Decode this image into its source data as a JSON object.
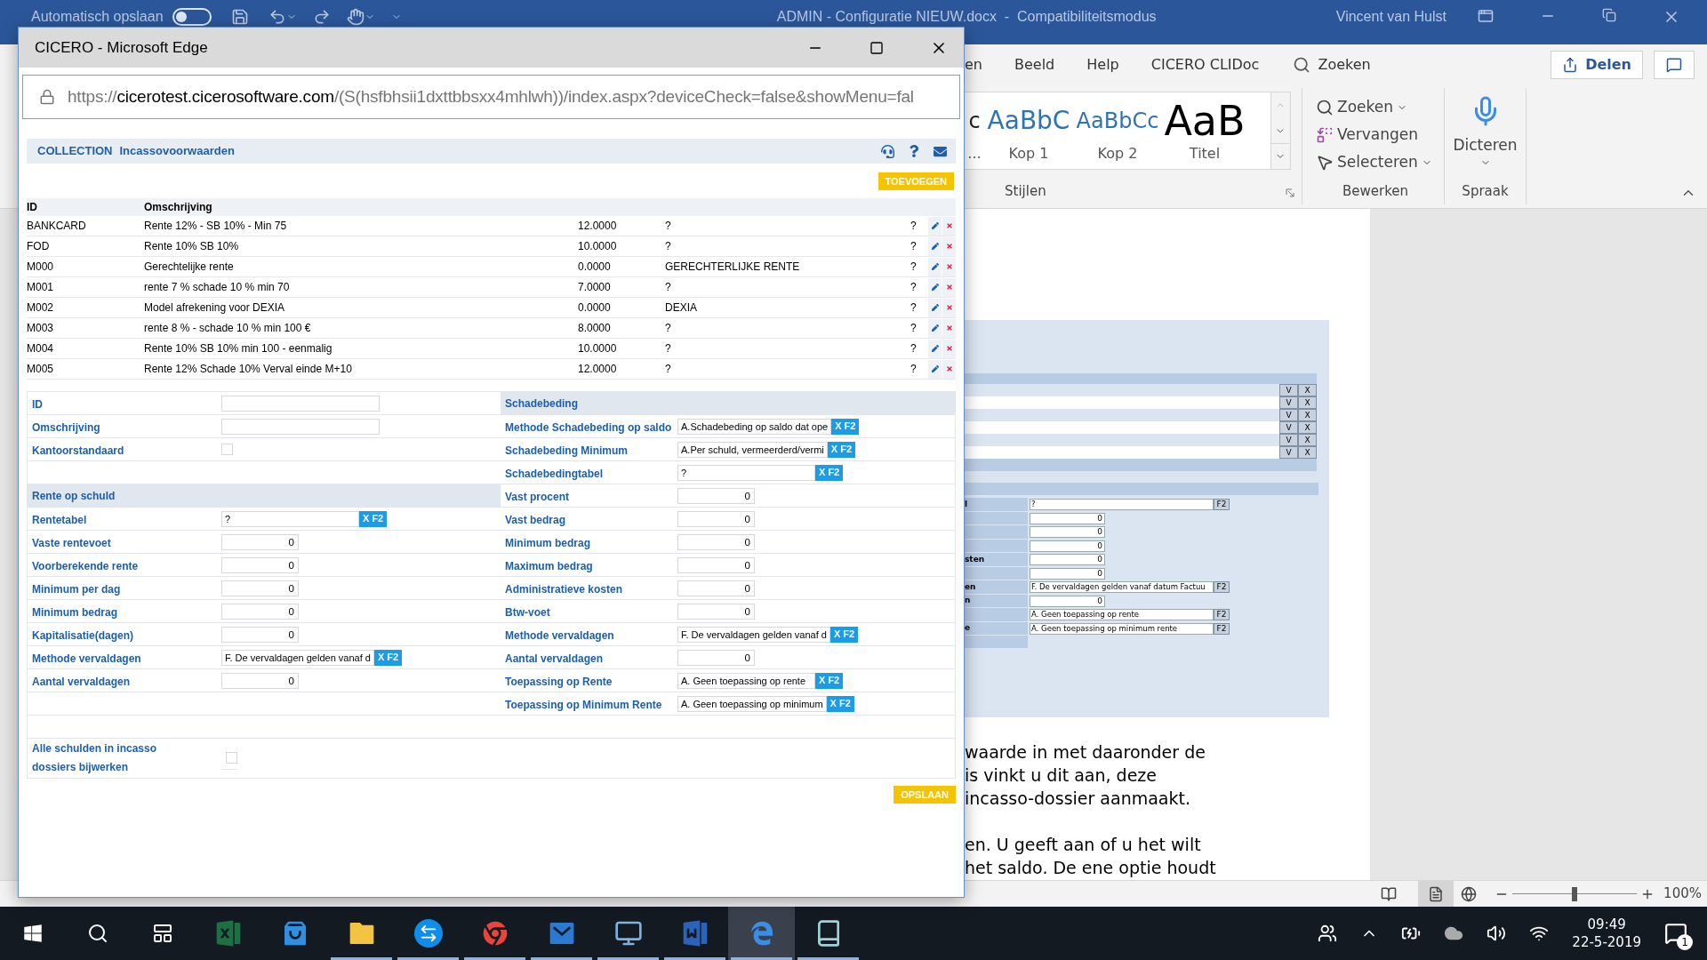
{
  "word": {
    "autosave": {
      "label": "Automatisch opslaan",
      "on": false
    },
    "title": "ADMIN - Configuratie NIEUW.docx  -  Compatibiliteitsmodus",
    "user": "Vincent van Hulst",
    "ribbon_tabs": [
      {
        "label": "en",
        "selected": false
      },
      {
        "label": "Beeld",
        "selected": false
      },
      {
        "label": "Help",
        "selected": false
      },
      {
        "label": "CICERO CLIDoc",
        "selected": false
      }
    ],
    "tell_me": "Zoeken",
    "share": "Delen",
    "styles": {
      "group": "Stijlen",
      "items": [
        {
          "kind": "normal",
          "preview": "c",
          "label": "..."
        },
        {
          "kind": "heading1",
          "preview": "AaBbC",
          "label": "Kop 1"
        },
        {
          "kind": "heading2",
          "preview": "AaBbCc",
          "label": "Kop 2"
        },
        {
          "kind": "title",
          "preview": "AaB",
          "label": "Titel"
        }
      ]
    },
    "editing": {
      "group": "Bewerken",
      "items": [
        {
          "kind": "find",
          "label": "Zoeken"
        },
        {
          "kind": "replace",
          "label": "Vervangen"
        },
        {
          "kind": "select",
          "label": "Selecteren"
        }
      ]
    },
    "voice": {
      "group": "Spraak",
      "label": "Dicteren"
    },
    "document": {
      "embedded_form": {
        "action_rows": [
          {
            "confirm": "V",
            "remove": "X"
          },
          {
            "confirm": "V",
            "remove": "X"
          },
          {
            "confirm": "V",
            "remove": "X"
          },
          {
            "confirm": "V",
            "remove": "X"
          },
          {
            "confirm": "V",
            "remove": "X"
          },
          {
            "confirm": "V",
            "remove": "X"
          }
        ],
        "fields": [
          {
            "kind": "lookup",
            "label": "l",
            "value": "?",
            "button": "F2"
          },
          {
            "kind": "number",
            "value": "0"
          },
          {
            "kind": "number",
            "value": "0"
          },
          {
            "kind": "number",
            "value": "0"
          },
          {
            "kind": "number",
            "label": "sten",
            "value": "0"
          },
          {
            "kind": "number",
            "value": "0"
          },
          {
            "kind": "lookup",
            "label": "en",
            "value": "F. De vervaldagen gelden vanaf datum Factuu",
            "button": "F2"
          },
          {
            "kind": "number",
            "label": "n",
            "value": "0"
          },
          {
            "kind": "lookup",
            "value": "A. Geen toepassing op rente",
            "button": "F2"
          },
          {
            "kind": "lookup",
            "label": "e",
            "value": "A. Geen toepassing op minimum rente",
            "button": "F2"
          }
        ]
      },
      "paragraphs": [
        [
          "waarde in met daaronder de",
          "is vinkt u dit aan, deze",
          "incasso-dossier aanmaakt."
        ],
        [
          "en. U geeft aan of u het wilt",
          "het saldo. De ene optie houdt"
        ]
      ]
    },
    "status_bar": {
      "zoom": {
        "level": 0.5,
        "reading": "100%"
      }
    }
  },
  "edge": {
    "title": "CICERO - Microsoft Edge",
    "url": {
      "scheme": "https://",
      "domain": "cicerotest.cicerosoftware.com",
      "path": "/(S(hsfbhsii1dxttbbsxx4mhlwh))/index.aspx?deviceCheck=false&showMenu=fal"
    },
    "page": {
      "module": "COLLECTION",
      "title": "Incassovoorwaarden",
      "add_button": "TOEVOEGEN",
      "table": {
        "columns": [
          "ID",
          "Omschrijving"
        ],
        "rows": [
          {
            "id": "BANKCARD",
            "omschrijving": "Rente 12% - SB 10% - Min 75",
            "column_3": "12.0000",
            "column_4": "?",
            "column_5": "?"
          },
          {
            "id": "FOD",
            "omschrijving": "Rente 10% SB 10%",
            "column_3": "10.0000",
            "column_4": "?",
            "column_5": "?"
          },
          {
            "id": "M000",
            "omschrijving": "Gerechtelijke rente",
            "column_3": "0.0000",
            "column_4": "GERECHTERLIJKE RENTE",
            "column_5": "?"
          },
          {
            "id": "M001",
            "omschrijving": "rente 7 % schade 10 % min 70",
            "column_3": "7.0000",
            "column_4": "?",
            "column_5": "?"
          },
          {
            "id": "M002",
            "omschrijving": "Model afrekening voor DEXIA",
            "column_3": "0.0000",
            "column_4": "DEXIA",
            "column_5": "?"
          },
          {
            "id": "M003",
            "omschrijving": "rente 8 % - schade 10 % min 100 €",
            "column_3": "8.0000",
            "column_4": "?",
            "column_5": "?"
          },
          {
            "id": "M004",
            "omschrijving": "Rente 10% SB 10% min 100 - eenmalig",
            "column_3": "10.0000",
            "column_4": "?",
            "column_5": "?"
          },
          {
            "id": "M005",
            "omschrijving": "Rente 12% Schade 10% Verval einde M+10",
            "column_3": "12.0000",
            "column_4": "?",
            "column_5": "?"
          }
        ]
      },
      "form": {
        "left": [
          {
            "kind": "text",
            "label": "ID"
          },
          {
            "kind": "text",
            "label": "Omschrijving"
          },
          {
            "kind": "checkbox",
            "label": "Kantoorstandaard",
            "checked": false
          },
          {
            "kind": "header",
            "label": "Rente op schuld"
          },
          {
            "kind": "lookup",
            "label": "Rentetabel",
            "value": "?",
            "button": "X F2"
          },
          {
            "kind": "number",
            "label": "Vaste rentevoet",
            "value": "0"
          },
          {
            "kind": "number",
            "label": "Voorberekende rente",
            "value": "0"
          },
          {
            "kind": "number",
            "label": "Minimum per dag",
            "value": "0"
          },
          {
            "kind": "number",
            "label": "Minimum bedrag",
            "value": "0"
          },
          {
            "kind": "number",
            "label": "Kapitalisatie(dagen)",
            "value": "0"
          },
          {
            "kind": "lookup",
            "label": "Methode vervaldagen",
            "value": "F. De vervaldagen gelden vanaf d",
            "button": "X F2"
          },
          {
            "kind": "number",
            "label": "Aantal vervaldagen",
            "value": "0"
          }
        ],
        "right": [
          {
            "kind": "header",
            "label": "Schadebeding"
          },
          {
            "kind": "lookup",
            "label": "Methode Schadebeding op saldo",
            "value": "A.Schadebeding op saldo dat ope",
            "button": "X F2"
          },
          {
            "kind": "lookup",
            "label": "Schadebeding Minimum",
            "value": "A.Per schuld, vermeerderd/vermi",
            "button": "X F2"
          },
          {
            "kind": "lookup",
            "label": "Schadebedingtabel",
            "value": "?",
            "button": "X F2"
          },
          {
            "kind": "number",
            "label": "Vast procent",
            "value": "0"
          },
          {
            "kind": "number",
            "label": "Vast bedrag",
            "value": "0"
          },
          {
            "kind": "number",
            "label": "Minimum bedrag",
            "value": "0"
          },
          {
            "kind": "number",
            "label": "Maximum bedrag",
            "value": "0"
          },
          {
            "kind": "number",
            "label": "Administratieve kosten",
            "value": "0"
          },
          {
            "kind": "number",
            "label": "Btw-voet",
            "value": "0"
          },
          {
            "kind": "lookup",
            "label": "Methode vervaldagen",
            "value": "F. De vervaldagen gelden vanaf d",
            "button": "X F2"
          },
          {
            "kind": "number",
            "label": "Aantal vervaldagen",
            "value": "0"
          },
          {
            "kind": "lookup",
            "label": "Toepassing op Rente",
            "value": "A. Geen toepassing op rente",
            "button": "X F2"
          },
          {
            "kind": "lookup",
            "label": "Toepassing op Minimum Rente",
            "value": "A. Geen toepassing op minimum",
            "button": "X F2"
          }
        ],
        "footer": {
          "kind": "checkbox",
          "label": "Alle schulden in incasso dossiers bijwerken",
          "checked": false
        }
      },
      "save_button": "OPSLAAN"
    }
  },
  "taskbar": {
    "apps": [
      {
        "kind": "excel",
        "open": false,
        "selected": false
      },
      {
        "kind": "store",
        "open": false,
        "selected": false
      },
      {
        "kind": "explorer",
        "open": true,
        "selected": false
      },
      {
        "kind": "teamviewer",
        "open": true,
        "selected": false
      },
      {
        "kind": "chrome",
        "open": true,
        "selected": false
      },
      {
        "kind": "outlook",
        "open": true,
        "selected": false
      },
      {
        "kind": "remote",
        "open": true,
        "selected": false
      },
      {
        "kind": "word",
        "open": true,
        "selected": false
      },
      {
        "kind": "edge",
        "open": true,
        "selected": true
      },
      {
        "kind": "notes",
        "open": true,
        "selected": false
      }
    ],
    "clock": {
      "time": "09:49",
      "date": "22-5-2019"
    },
    "notifications": "1"
  }
}
